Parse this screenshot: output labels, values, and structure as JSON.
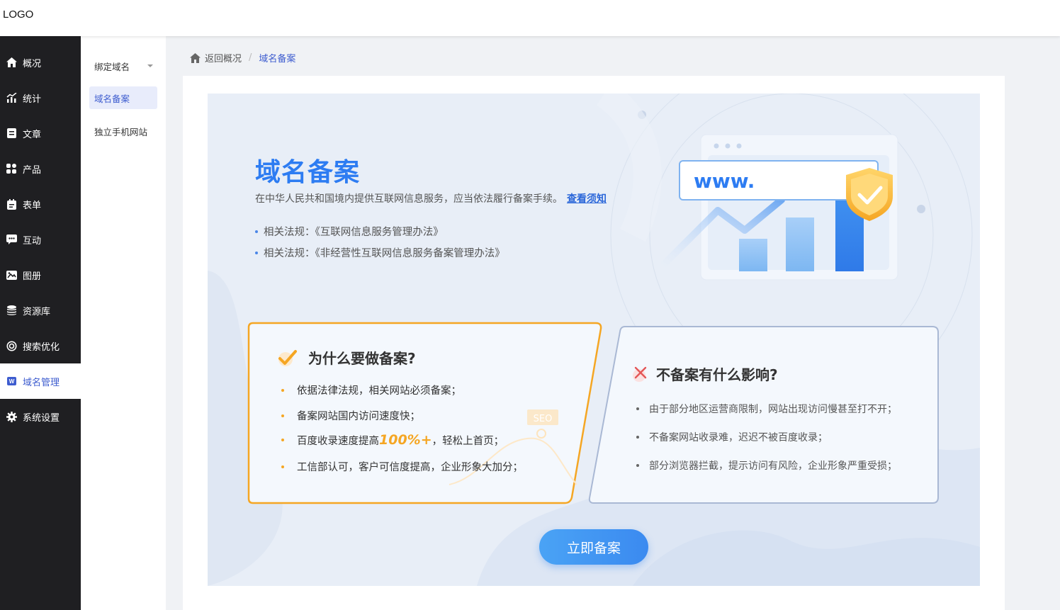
{
  "header": {
    "logo": "LOGO"
  },
  "sidebar": {
    "items": [
      {
        "label": "概况",
        "icon": "home-icon"
      },
      {
        "label": "统计",
        "icon": "chart-icon"
      },
      {
        "label": "文章",
        "icon": "article-icon"
      },
      {
        "label": "产品",
        "icon": "grid-icon"
      },
      {
        "label": "表单",
        "icon": "form-icon"
      },
      {
        "label": "互动",
        "icon": "chat-icon"
      },
      {
        "label": "图册",
        "icon": "album-icon"
      },
      {
        "label": "资源库",
        "icon": "database-icon"
      },
      {
        "label": "搜索优化",
        "icon": "seo-icon"
      },
      {
        "label": "域名管理",
        "icon": "domain-icon",
        "active": true
      },
      {
        "label": "系统设置",
        "icon": "gear-icon"
      }
    ]
  },
  "submenu": {
    "items": [
      {
        "label": "绑定域名"
      },
      {
        "label": "域名备案",
        "active": true
      },
      {
        "label": "独立手机网站"
      }
    ]
  },
  "breadcrumb": {
    "back": "返回概况",
    "separator": "/",
    "current": "域名备案"
  },
  "banner": {
    "title": "域名备案",
    "description": "在中华人民共和国境内提供互联网信息服务，应当依法履行备案手续。",
    "link": "查看须知",
    "laws": [
      "相关法规：《互联网信息服务管理办法》",
      "相关法规：《非经营性互联网信息服务备案管理办法》"
    ],
    "illustration_text": "www."
  },
  "why_card": {
    "title": "为什么要做备案?",
    "items": [
      "依据法律法规，相关网站必须备案；",
      "备案网站国内访问速度快；"
    ],
    "item3_before": "百度收录速度提高",
    "item3_highlight": "100%+",
    "item3_after": "，轻松上首页；",
    "item4": "工信部认可，客户可信度提高，企业形象大加分；",
    "seo_tag": "SEO"
  },
  "no_card": {
    "title": "不备案有什么影响?",
    "items": [
      "由于部分地区运营商限制，网站出现访问慢甚至打不开；",
      "不备案网站收录难，迟迟不被百度收录；",
      "部分浏览器拦截，提示访问有风险，企业形象严重受损；"
    ]
  },
  "cta": {
    "label": "立即备案"
  },
  "colors": {
    "accent": "#3d5ccf",
    "primary": "#2d7cf2",
    "orange": "#f5a623",
    "sidebar_bg": "#1f1f22"
  }
}
